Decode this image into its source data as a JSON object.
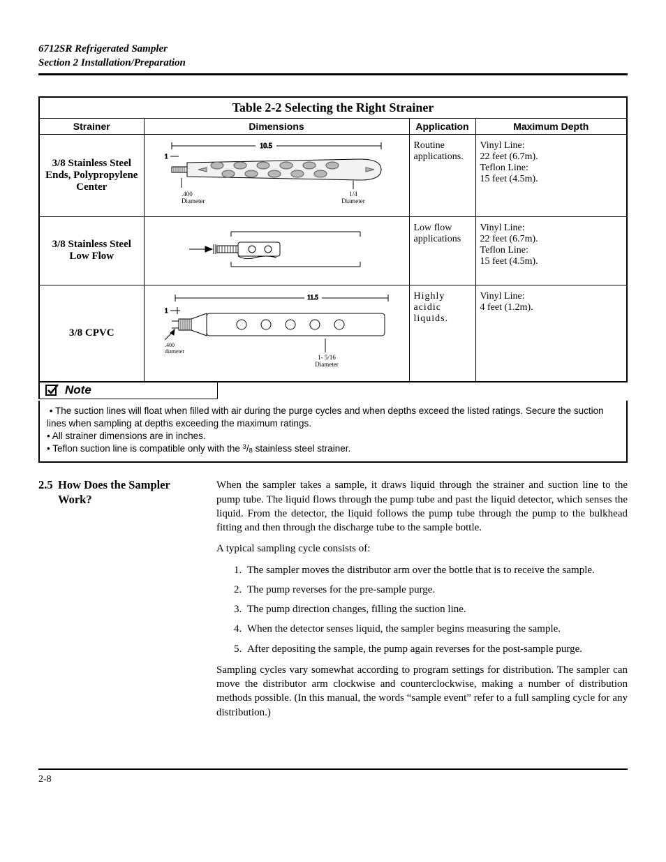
{
  "header": {
    "line1": "6712SR Refrigerated Sampler",
    "line2": "Section 2   Installation/Preparation"
  },
  "table": {
    "title": "Table 2-2  Selecting the Right Strainer",
    "columns": [
      "Strainer",
      "Dimensions",
      "Application",
      "Maximum Depth"
    ],
    "rows": [
      {
        "strainer": "3/8 Stainless Steel Ends, Polypropylene Center",
        "application": "Routine applications.",
        "depth_l1": "Vinyl Line:",
        "depth_l2": "22 feet (6.7m).",
        "depth_l3": "Teflon Line:",
        "depth_l4": "15 feet (4.5m).",
        "dim_top": "10.5",
        "dim_left_top": "1",
        "dim_bottom_left": ".400\nDiameter",
        "dim_bottom_right": "1/4\nDiameter"
      },
      {
        "strainer": "3/8 Stainless Steel Low Flow",
        "application": "Low flow applications",
        "depth_l1": "Vinyl Line:",
        "depth_l2": "22 feet (6.7m).",
        "depth_l3": "Teflon Line:",
        "depth_l4": "15 feet (4.5m)."
      },
      {
        "strainer": "3/8 CPVC",
        "application": "Highly acidic liquids.",
        "depth_l1": "Vinyl Line:",
        "depth_l2": "4 feet (1.2m).",
        "dim_top": "11.5",
        "dim_left_top": "1",
        "dim_bottom_left": ".400\ndiameter",
        "dim_bottom_right": "1- 5/16\nDiameter"
      }
    ]
  },
  "note": {
    "label": "Note",
    "bullet1": "The suction lines will float when filled with air during the purge cycles and when depths exceed the listed ratings. Secure the suction lines when sampling at depths exceeding the maximum ratings.",
    "bullet2": "All strainer dimensions are in inches.",
    "bullet3_pre": "Teflon suction line is compatible only with the ",
    "bullet3_frac_num": "3",
    "bullet3_frac_den": "8",
    "bullet3_post": " stainless steel strainer."
  },
  "section": {
    "number": "2.5",
    "title": "How Does the Sampler Work?",
    "p1": "When the sampler takes a sample, it draws liquid through the strainer and suction line to the pump tube. The liquid flows through the pump tube and past the liquid detector, which senses the liquid. From the detector, the liquid follows the pump tube through the pump to the bulkhead fitting and then through the discharge tube to the sample bottle.",
    "p2": "A typical sampling cycle consists of:",
    "steps": [
      "The sampler moves the distributor arm over the bottle that is to receive the sample.",
      "The pump reverses for the pre-sample purge.",
      "The pump direction changes, filling the suction line.",
      "When the detector senses liquid, the sampler begins measuring the sample.",
      "After depositing the sample, the pump again reverses for the post-sample purge."
    ],
    "p3": "Sampling cycles vary somewhat according to program settings for distribution. The sampler can move the distributor arm clockwise and counterclockwise, making a number of distribution methods possible. (In this manual, the words “sample event” refer to a full sampling cycle for any distribution.)"
  },
  "footer": {
    "page": "2-8"
  }
}
